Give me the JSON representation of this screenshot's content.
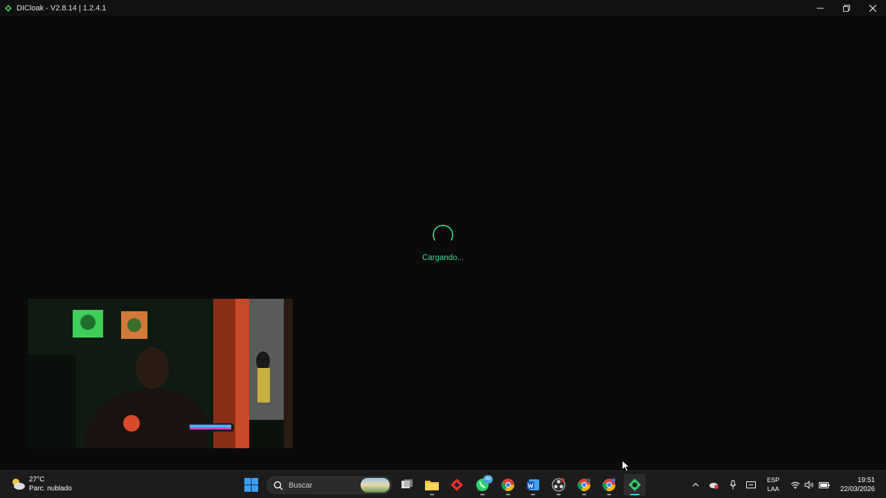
{
  "window": {
    "title": "DICloak - V2.8.14 | 1.2.4.1",
    "logo_icon": "dicloak-logo-icon",
    "controls": [
      "minimize-icon",
      "restore-icon",
      "close-icon"
    ]
  },
  "main": {
    "loading_text": "Cargando...",
    "accent_color": "#3ddc97",
    "background_color": "#0a0a0a"
  },
  "webcam": {
    "description_icon": "webcam-overlay"
  },
  "taskbar": {
    "weather": {
      "temperature": "27°C",
      "condition": "Parc. nublado",
      "icon": "partly-cloudy-icon"
    },
    "start_icon": "windows-start-icon",
    "search": {
      "placeholder": "Buscar"
    },
    "apps": [
      {
        "name": "task-view-icon"
      },
      {
        "name": "file-explorer-icon"
      },
      {
        "name": "anydesk-icon"
      },
      {
        "name": "whatsapp-icon",
        "badge": "49"
      },
      {
        "name": "chrome-icon"
      },
      {
        "name": "word-icon"
      },
      {
        "name": "obs-icon"
      },
      {
        "name": "chrome-profile-2-icon"
      },
      {
        "name": "chrome-profile-3-icon"
      },
      {
        "name": "dicloak-taskbar-icon",
        "active": true
      }
    ],
    "tray": {
      "language_line1": "ESP",
      "language_line2": "LAA",
      "time": "19:51",
      "date": "22/03/2026"
    }
  }
}
